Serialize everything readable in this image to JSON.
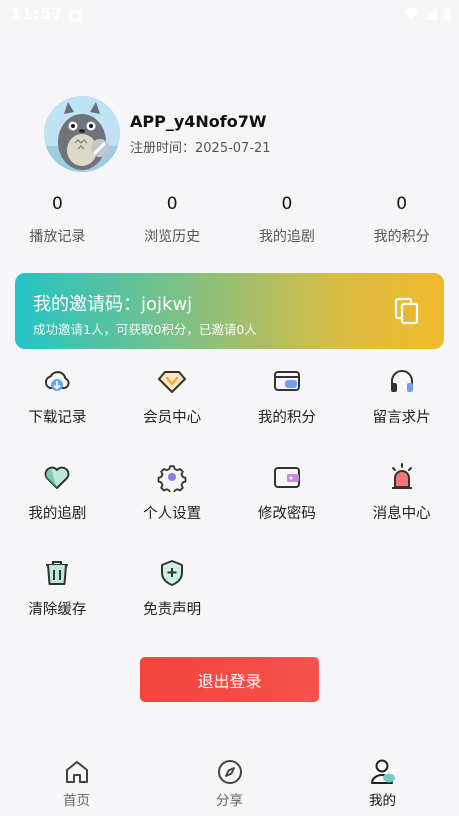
{
  "statusbar": {
    "time": "11:57"
  },
  "profile": {
    "username": "APP_y4Nofo7W",
    "register_label": "注册时间：",
    "register_date": "2025-07-21"
  },
  "stats": [
    {
      "value": "0",
      "label": "播放记录"
    },
    {
      "value": "0",
      "label": "浏览历史"
    },
    {
      "value": "0",
      "label": "我的追剧"
    },
    {
      "value": "0",
      "label": "我的积分"
    }
  ],
  "invite": {
    "code_line": "我的邀请码：jojkwj",
    "sub_line": "成功邀请1人，可获取0积分，已邀请0人"
  },
  "menu": [
    {
      "label": "下载记录",
      "icon": "cloud-download-icon"
    },
    {
      "label": "会员中心",
      "icon": "vip-diamond-icon"
    },
    {
      "label": "我的积分",
      "icon": "card-icon"
    },
    {
      "label": "留言求片",
      "icon": "headset-icon"
    },
    {
      "label": "我的追剧",
      "icon": "heart-icon"
    },
    {
      "label": "个人设置",
      "icon": "gear-icon"
    },
    {
      "label": "修改密码",
      "icon": "wallet-icon"
    },
    {
      "label": "消息中心",
      "icon": "alarm-light-icon"
    },
    {
      "label": "清除缓存",
      "icon": "trash-icon"
    },
    {
      "label": "免责声明",
      "icon": "shield-icon"
    }
  ],
  "logout_label": "退出登录",
  "tabbar": [
    {
      "label": "首页",
      "icon": "home-icon"
    },
    {
      "label": "分享",
      "icon": "compass-icon"
    },
    {
      "label": "我的",
      "icon": "user-icon",
      "active": true
    }
  ],
  "colors": {
    "accent_red": "#f2453d",
    "invite_gradient_start": "#22c4c6",
    "invite_gradient_end": "#f2ba2c",
    "icon_teal": "#5bbfa8",
    "icon_orange": "#f2a93b",
    "icon_blue": "#6f9ff0",
    "icon_red": "#f06060"
  }
}
